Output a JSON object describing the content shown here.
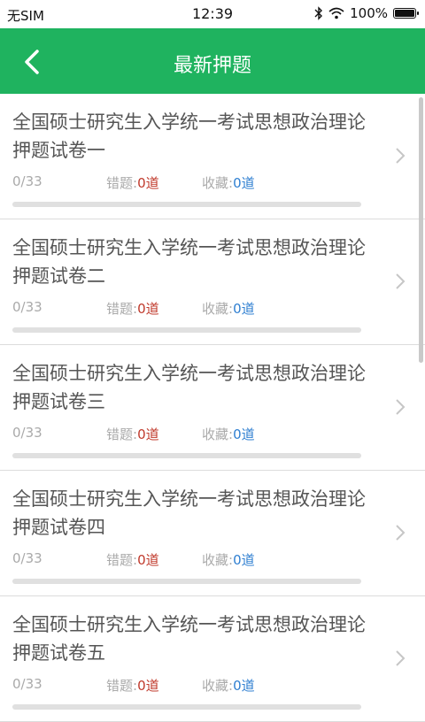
{
  "status": {
    "carrier": "无SIM",
    "time": "12:39",
    "battery": "100%"
  },
  "header": {
    "title": "最新押题"
  },
  "labels": {
    "errors": "错题:",
    "favorites": "收藏:"
  },
  "items": [
    {
      "name": "全国硕士研究生入学统一考试思想政治理论押题试卷一",
      "progress": "0/33",
      "errors": "0道",
      "favorites": "0道",
      "fill": 0
    },
    {
      "name": "全国硕士研究生入学统一考试思想政治理论押题试卷二",
      "progress": "0/33",
      "errors": "0道",
      "favorites": "0道",
      "fill": 0
    },
    {
      "name": "全国硕士研究生入学统一考试思想政治理论押题试卷三",
      "progress": "0/33",
      "errors": "0道",
      "favorites": "0道",
      "fill": 0
    },
    {
      "name": "全国硕士研究生入学统一考试思想政治理论押题试卷四",
      "progress": "0/33",
      "errors": "0道",
      "favorites": "0道",
      "fill": 0
    },
    {
      "name": "全国硕士研究生入学统一考试思想政治理论押题试卷五",
      "progress": "0/33",
      "errors": "0道",
      "favorites": "0道",
      "fill": 0
    }
  ],
  "colors": {
    "header": "#1fb35f",
    "errors": "#c0392b",
    "favorites": "#2f7fd1"
  }
}
